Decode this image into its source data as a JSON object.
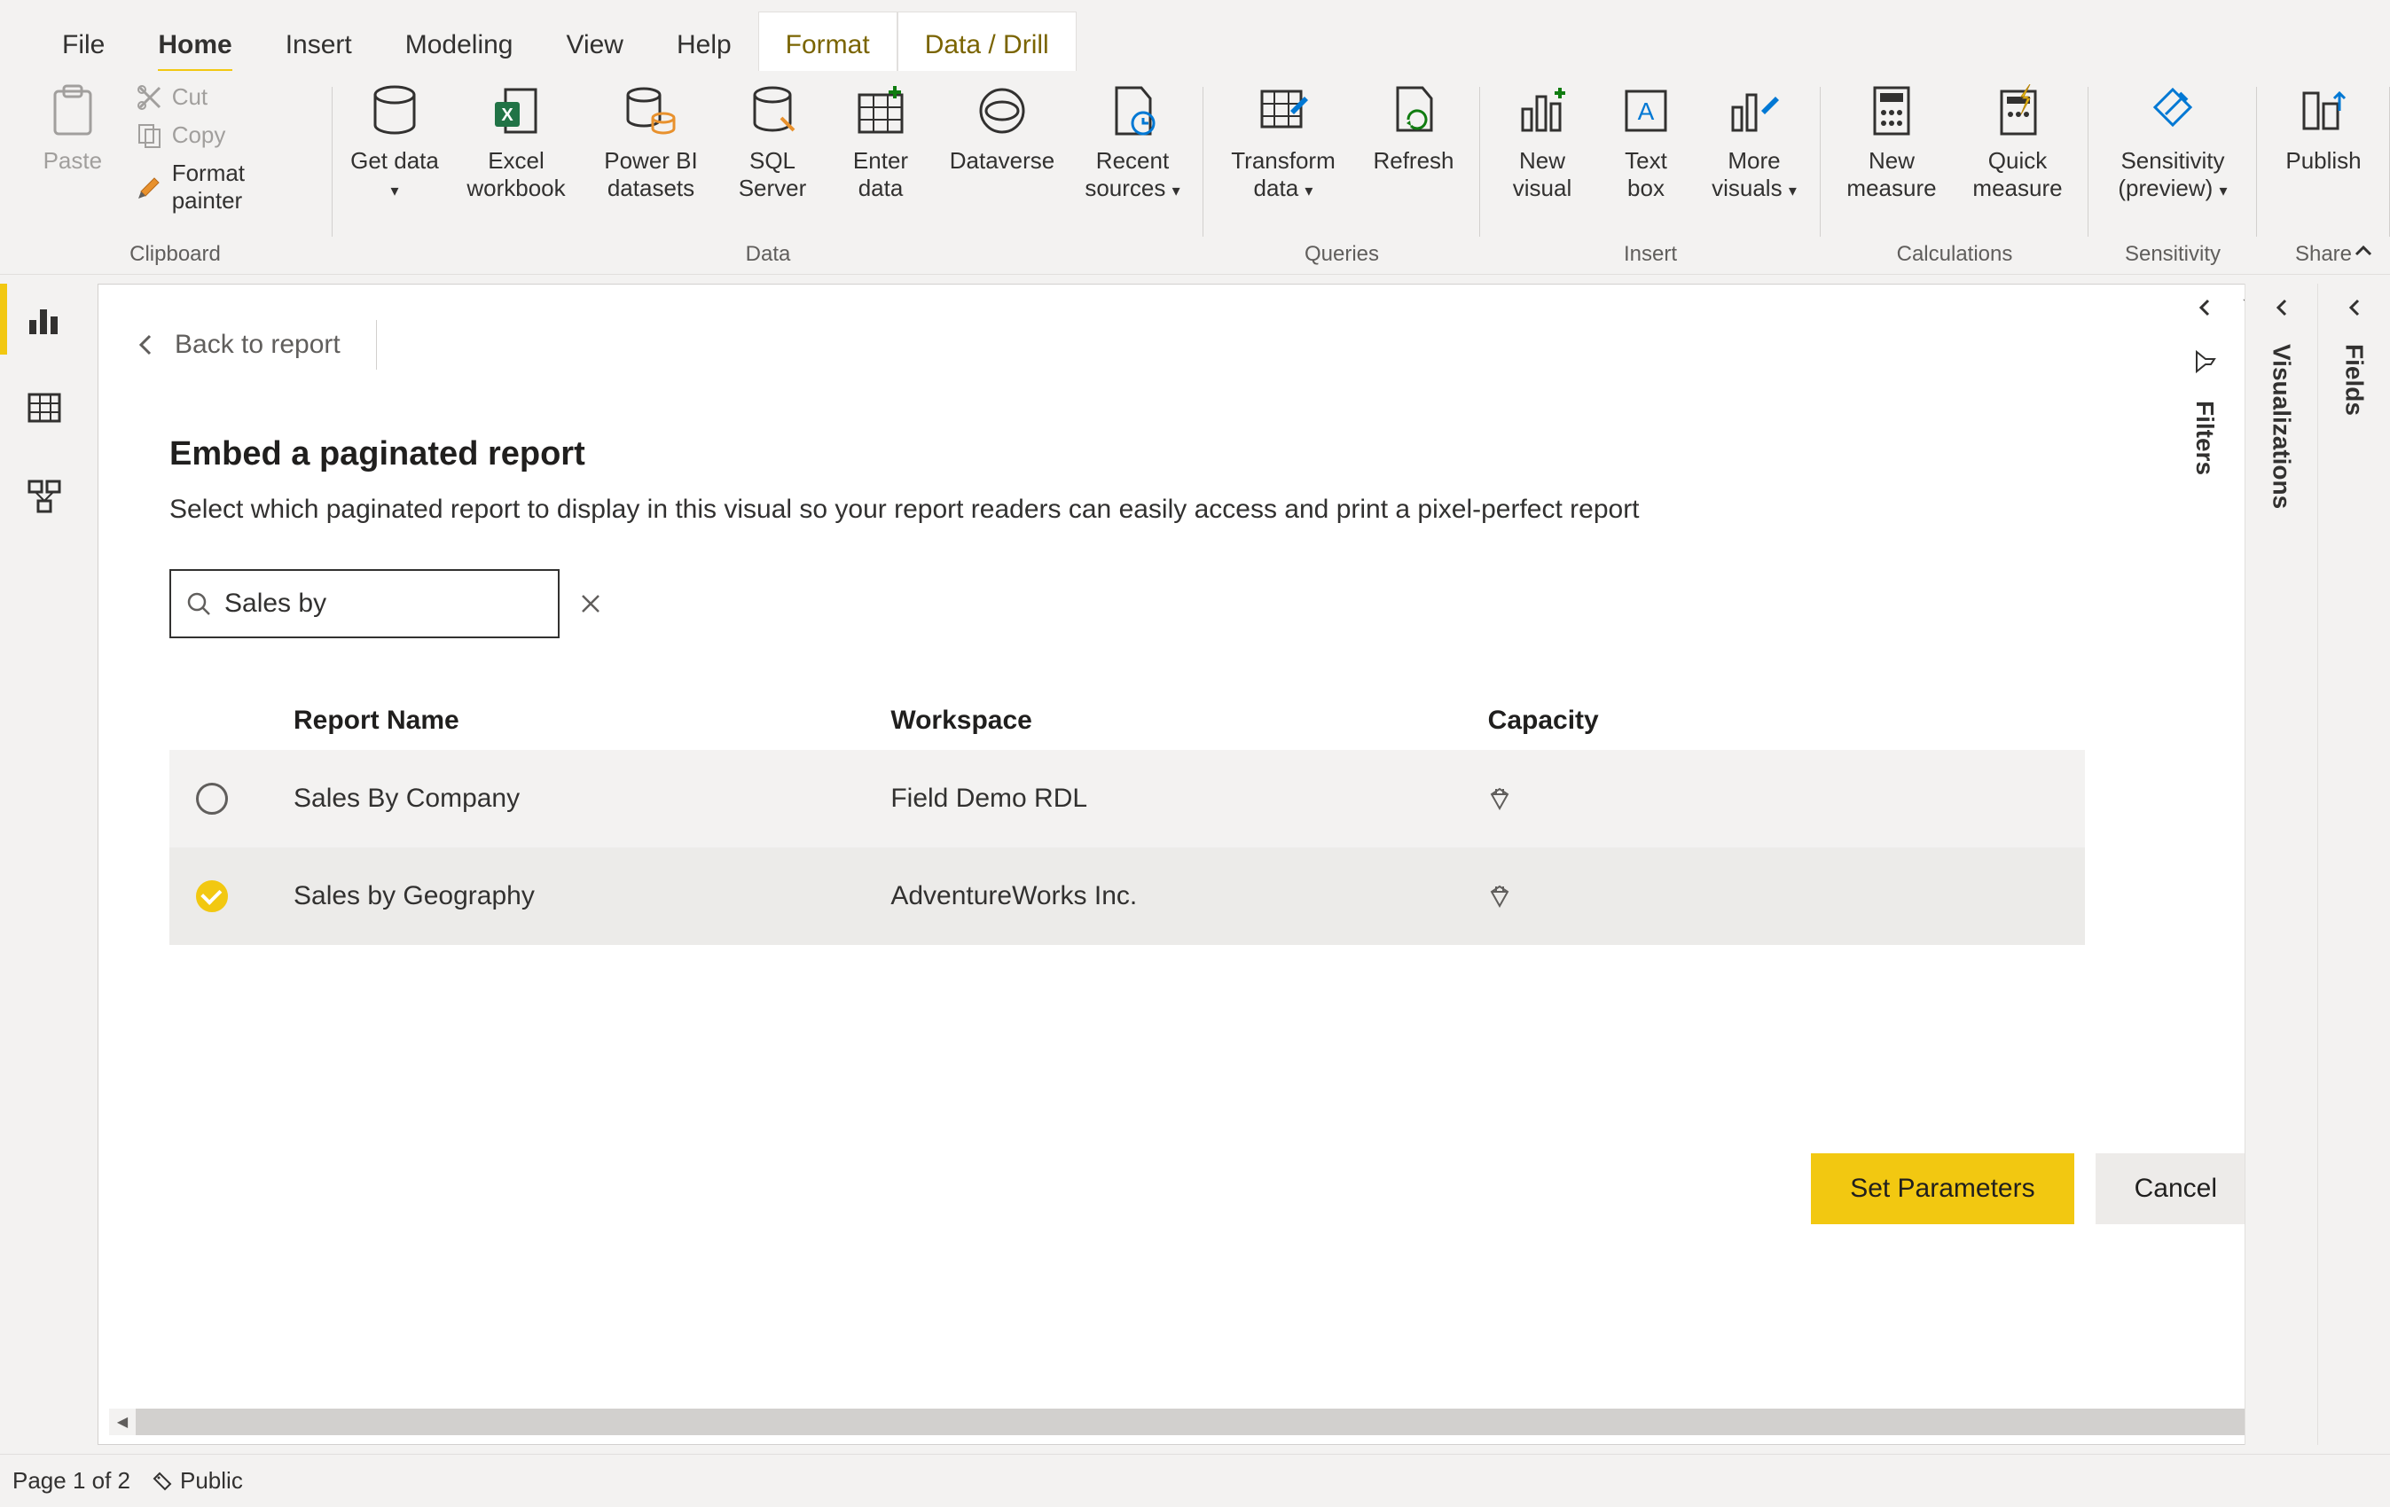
{
  "menu": {
    "tabs": [
      "File",
      "Home",
      "Insert",
      "Modeling",
      "View",
      "Help",
      "Format",
      "Data / Drill"
    ],
    "active": "Home"
  },
  "ribbon": {
    "clipboard": {
      "paste": "Paste",
      "cut": "Cut",
      "copy": "Copy",
      "format_painter": "Format painter",
      "group_label": "Clipboard"
    },
    "data": {
      "get_data": "Get data",
      "excel": "Excel workbook",
      "pbi_datasets": "Power BI datasets",
      "sql": "SQL Server",
      "enter_data": "Enter data",
      "dataverse": "Dataverse",
      "recent": "Recent sources",
      "group_label": "Data"
    },
    "queries": {
      "transform": "Transform data",
      "refresh": "Refresh",
      "group_label": "Queries"
    },
    "insert": {
      "new_visual": "New visual",
      "text_box": "Text box",
      "more_visuals": "More visuals",
      "group_label": "Insert"
    },
    "calculations": {
      "new_measure": "New measure",
      "quick_measure": "Quick measure",
      "group_label": "Calculations"
    },
    "sensitivity": {
      "sensitivity": "Sensitivity (preview)",
      "group_label": "Sensitivity"
    },
    "share": {
      "publish": "Publish",
      "group_label": "Share"
    }
  },
  "back_link": "Back to report",
  "panel": {
    "title": "Embed a paginated report",
    "description": "Select which paginated report to display in this visual so your report readers can easily access and print a pixel-perfect report",
    "search_value": "Sales by",
    "columns": {
      "name": "Report Name",
      "workspace": "Workspace",
      "capacity": "Capacity"
    },
    "rows": [
      {
        "selected": false,
        "name": "Sales By Company",
        "workspace": "Field Demo RDL"
      },
      {
        "selected": true,
        "name": "Sales by Geography",
        "workspace": "AdventureWorks Inc."
      }
    ],
    "set_parameters": "Set Parameters",
    "cancel": "Cancel"
  },
  "panes": {
    "filters": "Filters",
    "visualizations": "Visualizations",
    "fields": "Fields"
  },
  "status": {
    "page": "Page 1 of 2",
    "sensitivity": "Public"
  }
}
